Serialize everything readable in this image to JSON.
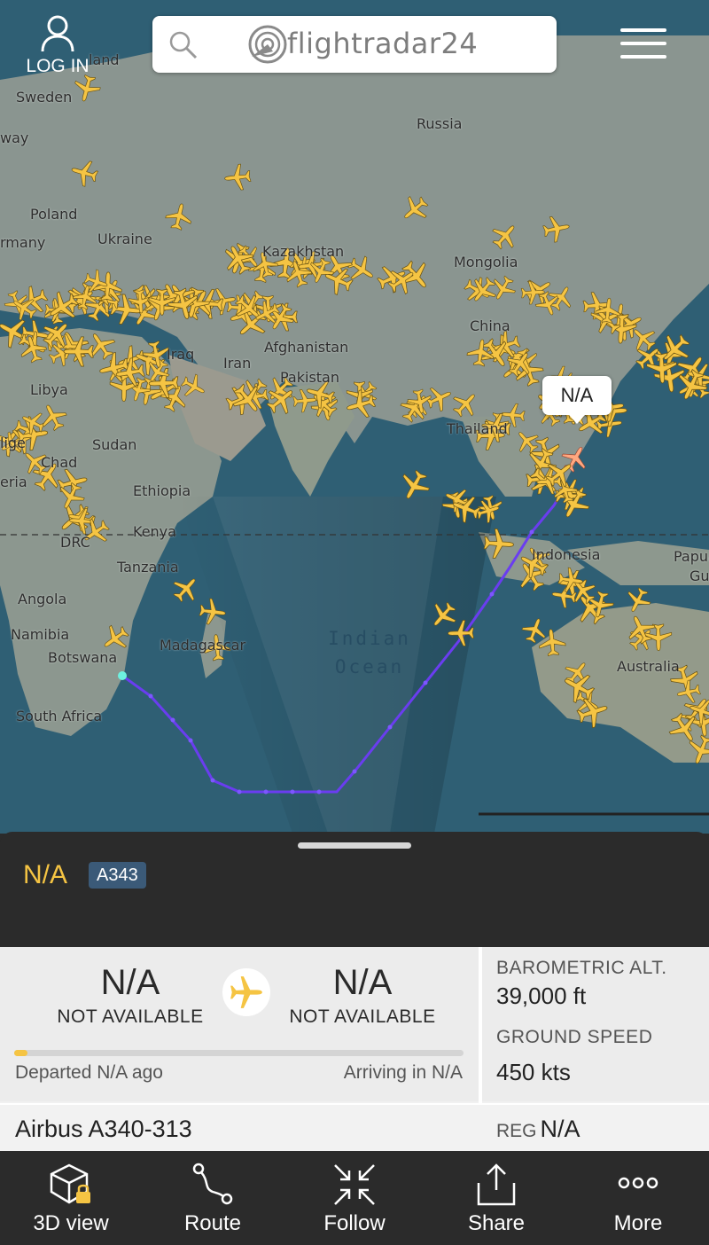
{
  "header": {
    "login_label": "LOG IN",
    "search_logo_text": "flightradar24"
  },
  "map": {
    "places": [
      {
        "key": "russia",
        "label": "Russia"
      },
      {
        "key": "sweden",
        "label": "Sweden"
      },
      {
        "key": "way",
        "label": "way"
      },
      {
        "key": "land",
        "label": "land"
      },
      {
        "key": "poland",
        "label": "Poland"
      },
      {
        "key": "many",
        "label": "rmany"
      },
      {
        "key": "ukraine",
        "label": "Ukraine"
      },
      {
        "key": "kazakhstan",
        "label": "Kazakhstan"
      },
      {
        "key": "mongolia",
        "label": "Mongolia"
      },
      {
        "key": "china",
        "label": "China"
      },
      {
        "key": "iraq",
        "label": "Iraq"
      },
      {
        "key": "iran",
        "label": "Iran"
      },
      {
        "key": "afghanistan",
        "label": "Afghanistan"
      },
      {
        "key": "pakistan",
        "label": "Pakistan"
      },
      {
        "key": "libya",
        "label": "Libya"
      },
      {
        "key": "sudan",
        "label": "Sudan"
      },
      {
        "key": "chad",
        "label": "Chad"
      },
      {
        "key": "niger",
        "label": "lige"
      },
      {
        "key": "nigeria",
        "label": "eria"
      },
      {
        "key": "ethiopia",
        "label": "Ethiopia"
      },
      {
        "key": "kenya",
        "label": "Kenya"
      },
      {
        "key": "drc",
        "label": "DRC"
      },
      {
        "key": "tanzania",
        "label": "Tanzania"
      },
      {
        "key": "angola",
        "label": "Angola"
      },
      {
        "key": "namibia",
        "label": "Namibia"
      },
      {
        "key": "botswana",
        "label": "Botswana"
      },
      {
        "key": "madagascar",
        "label": "Madagascar"
      },
      {
        "key": "south_africa",
        "label": "South Africa"
      },
      {
        "key": "thailand",
        "label": "Thailand"
      },
      {
        "key": "indonesia",
        "label": "Indonesia"
      },
      {
        "key": "papua",
        "label": "Papua"
      },
      {
        "key": "gu",
        "label": "Gu"
      },
      {
        "key": "australia",
        "label": "Australia"
      }
    ],
    "ocean_label_line1": "Indian",
    "ocean_label_line2": "Ocean",
    "selected_flight_callout": "N/A",
    "colors": {
      "plane": "#f5c443",
      "track": "#7a3cf0",
      "water": "#2f5f74",
      "land": "#8a9590"
    }
  },
  "flight": {
    "callsign": "N/A",
    "aircraft_type_code": "A343",
    "origin_code": "N/A",
    "origin_name": "NOT AVAILABLE",
    "destination_code": "N/A",
    "destination_name": "NOT AVAILABLE",
    "departed_text": "Departed N/A ago",
    "arriving_text": "Arriving in N/A",
    "progress_fraction": 0.03,
    "barometric_alt_label": "BAROMETRIC ALT.",
    "barometric_alt_value": "39,000 ft",
    "ground_speed_label": "GROUND SPEED",
    "ground_speed_value": "450 kts",
    "aircraft_model": "Airbus A340-313",
    "reg_label": "REG",
    "reg_value": "N/A"
  },
  "tabbar": {
    "items": [
      {
        "label": "3D view",
        "icon": "cube-lock-icon"
      },
      {
        "label": "Route",
        "icon": "route-icon"
      },
      {
        "label": "Follow",
        "icon": "follow-arrows-icon"
      },
      {
        "label": "Share",
        "icon": "share-icon"
      },
      {
        "label": "More",
        "icon": "more-dots-icon"
      }
    ]
  }
}
